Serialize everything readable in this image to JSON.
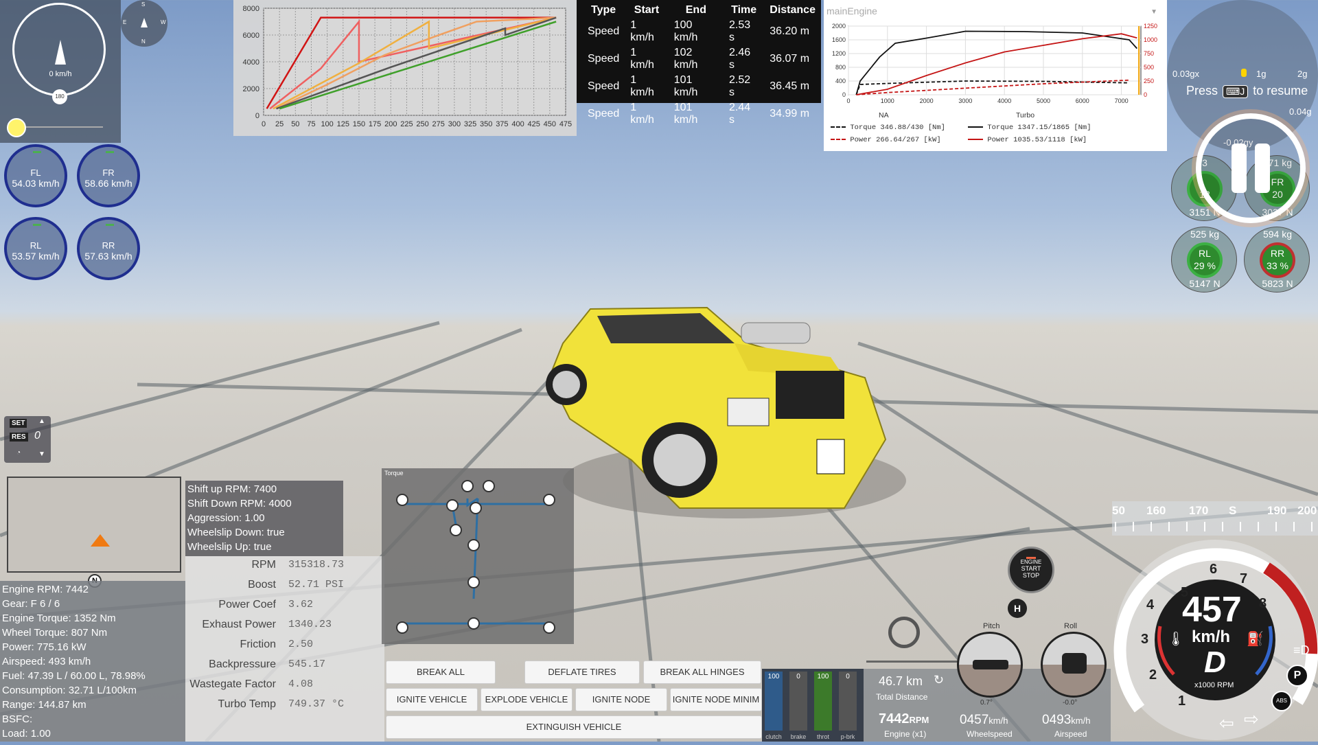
{
  "speedometer": {
    "value": "0 km/h",
    "max": "180"
  },
  "compass": {
    "n": "N",
    "s": "S",
    "e": "E",
    "w": "W"
  },
  "wheels": [
    {
      "name": "FL",
      "speed": "54.03 km/h"
    },
    {
      "name": "FR",
      "speed": "58.66 km/h"
    },
    {
      "name": "RL",
      "speed": "53.57 km/h"
    },
    {
      "name": "RR",
      "speed": "57.63 km/h"
    }
  ],
  "chart_data": [
    {
      "type": "line",
      "x_ticks": [
        "0",
        "25",
        "50",
        "75",
        "100",
        "125",
        "150",
        "175",
        "200",
        "225",
        "250",
        "275",
        "300",
        "325",
        "350",
        "375",
        "400",
        "425",
        "450",
        "475"
      ],
      "y_ticks": [
        "0",
        "2000",
        "4000",
        "6000",
        "8000"
      ],
      "xlim": [
        0,
        475
      ],
      "ylim": [
        0,
        8000
      ],
      "series": [
        {
          "color": "#d11414",
          "points": [
            [
              5,
              500
            ],
            [
              90,
              7300
            ],
            [
              90,
              7300
            ],
            [
              460,
              7300
            ]
          ]
        },
        {
          "color": "#ef6060",
          "points": [
            [
              10,
              500
            ],
            [
              90,
              3500
            ],
            [
              150,
              7000
            ],
            [
              150,
              4000
            ],
            [
              460,
              7300
            ]
          ]
        },
        {
          "color": "#f0b040",
          "points": [
            [
              15,
              500
            ],
            [
              150,
              3900
            ],
            [
              260,
              7000
            ],
            [
              260,
              5000
            ],
            [
              460,
              7300
            ]
          ]
        },
        {
          "color": "#f0a060",
          "points": [
            [
              20,
              500
            ],
            [
              100,
              2300
            ],
            [
              190,
              4500
            ],
            [
              270,
              5900
            ],
            [
              335,
              7000
            ],
            [
              460,
              7300
            ]
          ]
        },
        {
          "color": "#555555",
          "points": [
            [
              20,
              500
            ],
            [
              200,
              3600
            ],
            [
              380,
              6500
            ],
            [
              380,
              6000
            ],
            [
              460,
              7300
            ]
          ]
        },
        {
          "color": "#3fa02a",
          "points": [
            [
              25,
              500
            ],
            [
              460,
              7000
            ]
          ]
        }
      ]
    },
    {
      "type": "line",
      "x_ticks": [
        "0",
        "1000",
        "2000",
        "3000",
        "4000",
        "5000",
        "6000",
        "7000"
      ],
      "y_left_ticks": [
        "0",
        "400",
        "800",
        "1200",
        "1600",
        "2000"
      ],
      "y_right_ticks": [
        "0",
        "250",
        "500",
        "750",
        "1000",
        "1250"
      ],
      "xlim": [
        0,
        7500
      ],
      "ylim_left": [
        0,
        2000
      ],
      "ylim_right": [
        0,
        1250
      ],
      "series": [
        {
          "name": "NA Torque",
          "color": "#111111",
          "dashed": true,
          "points": [
            [
              200,
              0
            ],
            [
              300,
              300
            ],
            [
              1000,
              330
            ],
            [
              3000,
              400
            ],
            [
              5000,
              390
            ],
            [
              7200,
              346
            ]
          ]
        },
        {
          "name": "NA Power",
          "color": "#c41414",
          "dashed": true,
          "points": [
            [
              200,
              0
            ],
            [
              1000,
              40
            ],
            [
              3000,
              120
            ],
            [
              5000,
              200
            ],
            [
              7200,
              266
            ]
          ]
        },
        {
          "name": "Turbo Torque",
          "color": "#111111",
          "dashed": false,
          "points": [
            [
              200,
              0
            ],
            [
              300,
              400
            ],
            [
              800,
              1100
            ],
            [
              1200,
              1500
            ],
            [
              2000,
              1650
            ],
            [
              3000,
              1850
            ],
            [
              4500,
              1840
            ],
            [
              6000,
              1800
            ],
            [
              7200,
              1600
            ],
            [
              7400,
              1347
            ]
          ]
        },
        {
          "name": "Turbo Power",
          "color": "#c41414",
          "dashed": false,
          "points": [
            [
              200,
              0
            ],
            [
              1000,
              100
            ],
            [
              2000,
              350
            ],
            [
              3000,
              580
            ],
            [
              4000,
              780
            ],
            [
              5000,
              900
            ],
            [
              6000,
              1020
            ],
            [
              7000,
              1110
            ],
            [
              7400,
              1035
            ]
          ]
        }
      ],
      "redline_x": 7450
    }
  ],
  "times_table": {
    "headers": [
      "Type",
      "Start",
      "End",
      "Time",
      "Distance"
    ],
    "rows": [
      [
        "Speed",
        "1 km/h",
        "100 km/h",
        "2.53 s",
        "36.20 m"
      ],
      [
        "Speed",
        "1 km/h",
        "102 km/h",
        "2.46 s",
        "36.07 m"
      ],
      [
        "Speed",
        "1 km/h",
        "101 km/h",
        "2.52 s",
        "36.45 m"
      ],
      [
        "Speed",
        "1 km/h",
        "101 km/h",
        "2.44 s",
        "34.99 m"
      ]
    ]
  },
  "dyno": {
    "selector": "mainEngine",
    "na_title": "NA",
    "turbo_title": "Turbo",
    "na_torque": "Torque 346.88/430 [Nm]",
    "na_power": "Power 266.64/267 [kW]",
    "turbo_torque": "Torque 1347.15/1865 [Nm]",
    "turbo_power": "Power 1035.53/1118 [kW]"
  },
  "gmeter": {
    "g1": "0.03gx",
    "g2": "1g",
    "g3": "2g",
    "g4": "0.04g",
    "g5": "-0.02gy"
  },
  "resume": {
    "press": "Press",
    "key": "J",
    "to_resume": "to resume"
  },
  "tyres": [
    {
      "name": "FL",
      "kg": "3",
      "percent": "18",
      "load": "3151 N"
    },
    {
      "name": "FR",
      "kg": "371 kg",
      "percent": "20",
      "load": "3037 N"
    },
    {
      "name": "RL",
      "kg": "525 kg",
      "percent": "29 %",
      "load": "5147 N"
    },
    {
      "name": "RR",
      "kg": "594 kg",
      "percent": "33 %",
      "load": "5823 N"
    }
  ],
  "cruise": {
    "set": "SET",
    "res": "RES",
    "value": "0"
  },
  "minimap": {
    "north": "N"
  },
  "stats": [
    "Engine RPM: 7442",
    "Gear: F 6 / 6",
    "Engine Torque: 1352 Nm",
    "Wheel Torque: 807 Nm",
    "Power: 775.16 kW",
    "Airspeed: 493 km/h",
    "Fuel: 47.39 L / 60.00 L, 78.98%",
    "Consumption: 32.71 L/100km",
    "Range: 144.87 km",
    "BSFC:",
    "Load: 1.00"
  ],
  "shift": [
    "Shift up RPM: 7400",
    "Shift Down RPM: 4000",
    "Aggression: 1.00",
    "Wheelslip Down: true",
    "Wheelslip Up: true"
  ],
  "turbo": [
    {
      "label": "RPM",
      "value": "315318.73"
    },
    {
      "label": "Boost",
      "value": "52.71 PSI"
    },
    {
      "label": "Power Coef",
      "value": "3.62"
    },
    {
      "label": "Exhaust Power",
      "value": "1340.23"
    },
    {
      "label": "Friction",
      "value": "2.50"
    },
    {
      "label": "Backpressure",
      "value": "545.17"
    },
    {
      "label": "Wastegate Factor",
      "value": "4.08"
    },
    {
      "label": "Turbo Temp",
      "value": "749.37 °C"
    }
  ],
  "tree": {
    "title": "Torque"
  },
  "buttons": {
    "break_breakgroups": "BREAK ALL BREAKGROUPS",
    "deflate_tires": "DEFLATE TIRES",
    "break_hinges": "BREAK ALL HINGES",
    "ignite_vehicle": "IGNITE VEHICLE",
    "explode_vehicle": "EXPLODE VEHICLE",
    "ignite_node": "IGNITE NODE",
    "ignite_node_mini": "IGNITE NODE MINIM",
    "extinguish": "EXTINGUISH VEHICLE"
  },
  "pedals": [
    {
      "label": "clutch",
      "value": "100",
      "fill": 1.0,
      "color": "#2f5b8a"
    },
    {
      "label": "brake",
      "value": "0",
      "fill": 0.0,
      "color": "#a33"
    },
    {
      "label": "throt",
      "value": "100",
      "fill": 1.0,
      "color": "#3c7a2a"
    },
    {
      "label": "p-brk",
      "value": "0",
      "fill": 0.0,
      "color": "#777"
    }
  ],
  "info": {
    "distance": "46.7 km",
    "distance_label": "Total Distance",
    "rpm": "7442",
    "rpm_unit": "RPM",
    "rpm_label": "Engine (x1)",
    "wheel_speed": "0457",
    "wheel_unit": "km/h",
    "wheel_label": "Wheelspeed",
    "air_speed": "0493",
    "air_unit": "km/h",
    "air_label": "Airspeed"
  },
  "startstop": {
    "line1": "ENGINE",
    "line2": "START",
    "line3": "STOP"
  },
  "hbrake": "H",
  "attitude": {
    "pitch_label": "Pitch",
    "roll_label": "Roll",
    "pitch_val": "0.7°",
    "roll_val": "-0.0°"
  },
  "heading": {
    "ticks": [
      "50",
      "160",
      "170",
      "S",
      "190",
      "200"
    ]
  },
  "dash": {
    "speed": "457",
    "unit": "km/h",
    "gear": "D",
    "rpm_label": "x1000 RPM",
    "ticks": [
      "1",
      "2",
      "3",
      "4",
      "5",
      "6",
      "7",
      "8"
    ],
    "park": "P",
    "abs": "ABS"
  }
}
